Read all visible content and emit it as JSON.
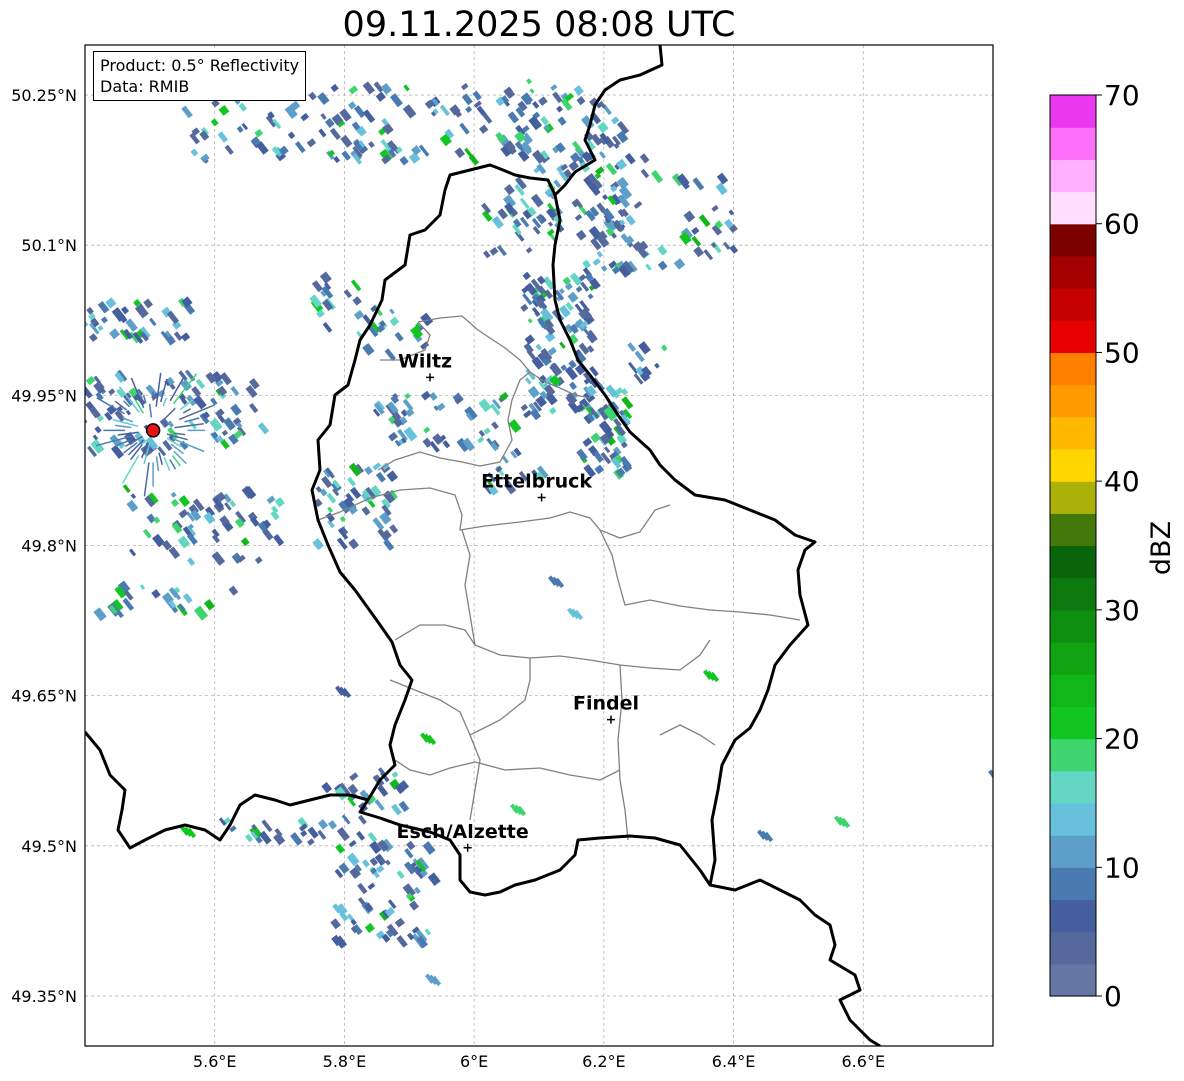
{
  "title": "09.11.2025 08:08 UTC",
  "info_box": {
    "product_line": "Product: 0.5° Reflectivity",
    "data_line": "Data: RMIB"
  },
  "map": {
    "lon_range": [
      5.4,
      6.8
    ],
    "lat_range": [
      49.3,
      50.3
    ],
    "x_ticks": [
      {
        "value": 5.6,
        "label": "5.6°E"
      },
      {
        "value": 5.8,
        "label": "5.8°E"
      },
      {
        "value": 6.0,
        "label": "6°E"
      },
      {
        "value": 6.2,
        "label": "6.2°E"
      },
      {
        "value": 6.4,
        "label": "6.4°E"
      },
      {
        "value": 6.6,
        "label": "6.6°E"
      }
    ],
    "y_ticks": [
      {
        "value": 50.25,
        "label": "50.25°N"
      },
      {
        "value": 50.1,
        "label": "50.1°N"
      },
      {
        "value": 49.95,
        "label": "49.95°N"
      },
      {
        "value": 49.8,
        "label": "49.8°N"
      },
      {
        "value": 49.65,
        "label": "49.65°N"
      },
      {
        "value": 49.5,
        "label": "49.5°N"
      },
      {
        "value": 49.35,
        "label": "49.35°N"
      }
    ],
    "radar_site": {
      "lon": 5.505,
      "lat": 49.915,
      "color": "#e8141a"
    },
    "cities": [
      {
        "name": "Wiltz",
        "lon": 5.932,
        "lat": 49.968
      },
      {
        "name": "Ettelbruck",
        "lon": 6.104,
        "lat": 49.848
      },
      {
        "name": "Findel",
        "lon": 6.211,
        "lat": 49.626
      },
      {
        "name": "Esch/Alzette",
        "lon": 5.99,
        "lat": 49.498
      }
    ]
  },
  "colorbar": {
    "label": "dBZ",
    "min": 0,
    "max": 70,
    "tick_labels": [
      "0",
      "10",
      "20",
      "30",
      "40",
      "50",
      "60",
      "70"
    ],
    "colors": [
      "#6677a6",
      "#55699d",
      "#445e9e",
      "#4a7bb0",
      "#5d9fc8",
      "#68c1db",
      "#63d7c4",
      "#3ed46e",
      "#12c621",
      "#11b619",
      "#10a412",
      "#0f8f10",
      "#0c7a0e",
      "#09640a",
      "#43780b",
      "#acb10a",
      "#ffd600",
      "#ffba00",
      "#ff9a00",
      "#ff7f00",
      "#e60000",
      "#c40000",
      "#a40000",
      "#7c0000",
      "#ffdefe",
      "#ffb1fd",
      "#ff70fa",
      "#eb38ef"
    ]
  }
}
